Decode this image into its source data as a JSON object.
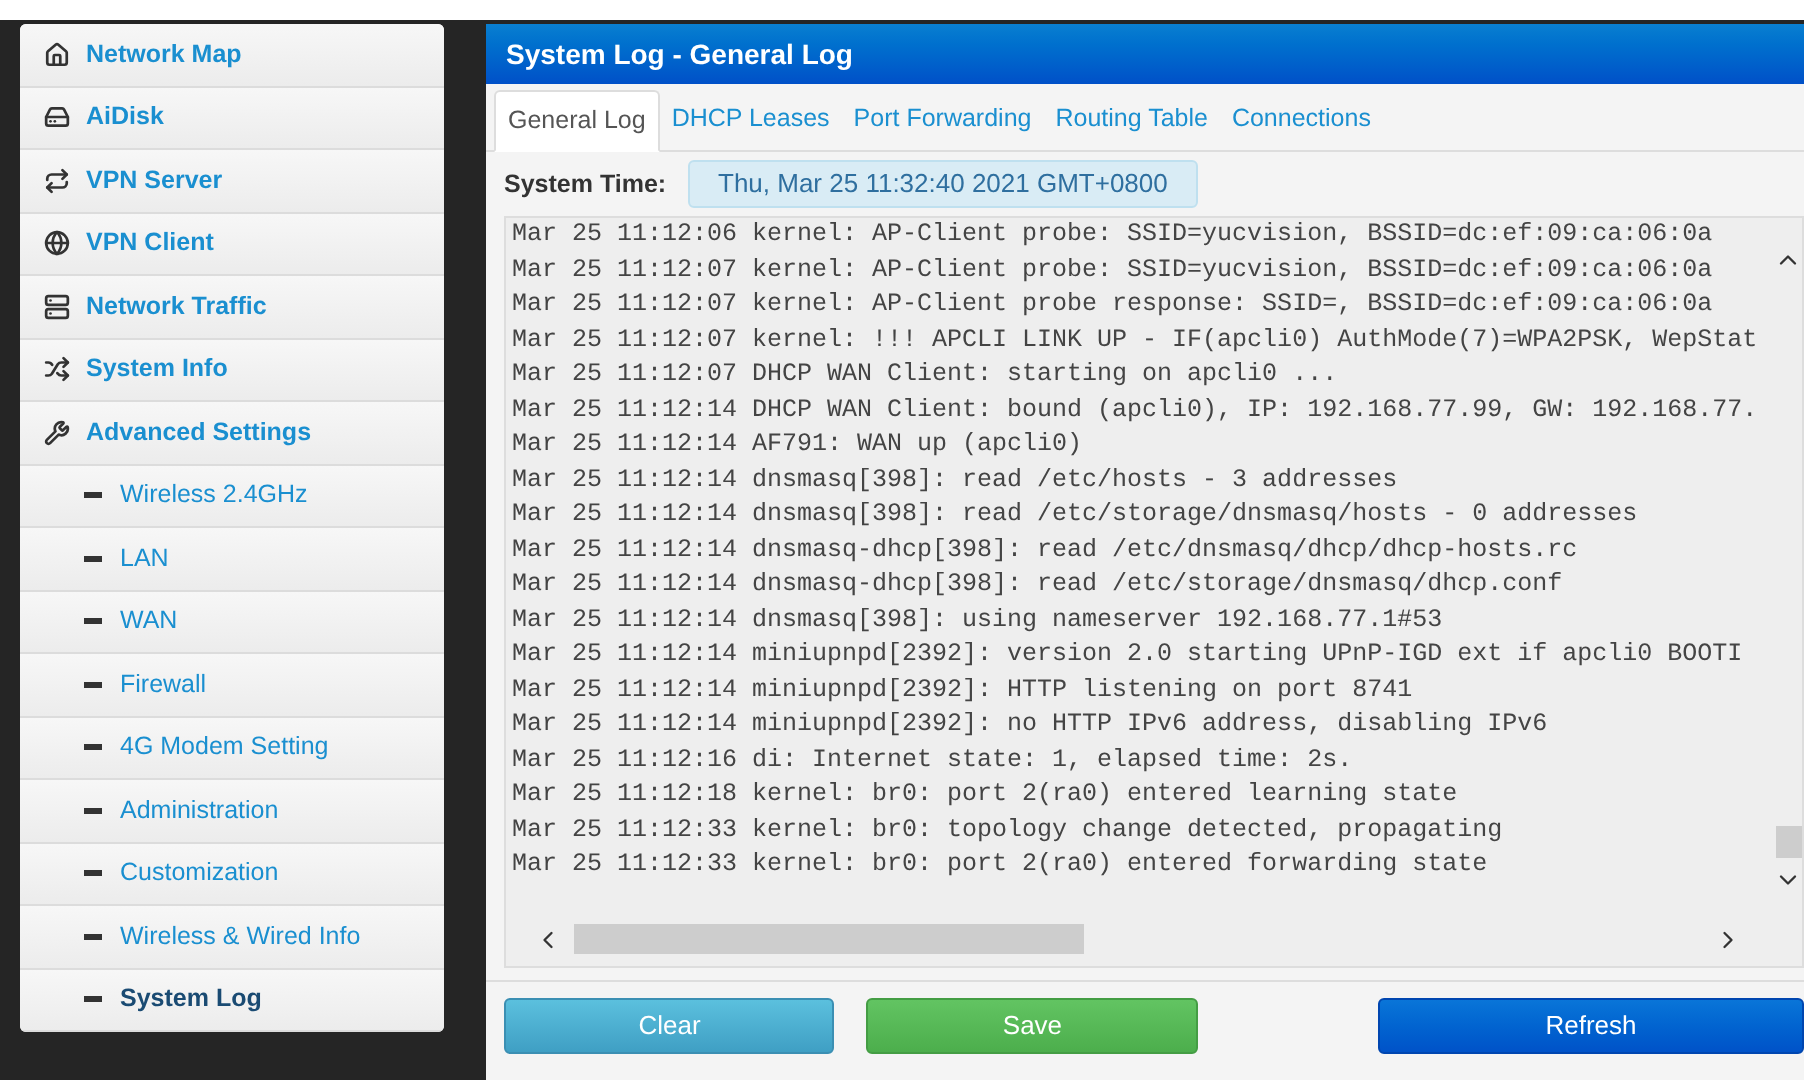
{
  "sidebar": {
    "items": [
      {
        "label": "Network Map",
        "selected": false
      },
      {
        "label": "AiDisk",
        "selected": false
      },
      {
        "label": "VPN Server",
        "selected": false
      },
      {
        "label": "VPN Client",
        "selected": false
      },
      {
        "label": "Network Traffic",
        "selected": false
      },
      {
        "label": "System Info",
        "selected": false
      },
      {
        "label": "Advanced Settings",
        "selected": false,
        "children": [
          {
            "label": "Wireless 2.4GHz",
            "selected": false
          },
          {
            "label": "LAN",
            "selected": false
          },
          {
            "label": "WAN",
            "selected": false
          },
          {
            "label": "Firewall",
            "selected": false
          },
          {
            "label": "4G Modem Setting",
            "selected": false
          },
          {
            "label": "Administration",
            "selected": false
          },
          {
            "label": "Customization",
            "selected": false
          },
          {
            "label": "Wireless & Wired Info",
            "selected": false
          },
          {
            "label": "System Log",
            "selected": true
          }
        ]
      }
    ]
  },
  "panel": {
    "title": "System Log - General Log",
    "tabs": [
      {
        "label": "General Log",
        "selected": true
      },
      {
        "label": "DHCP Leases",
        "selected": false
      },
      {
        "label": "Port Forwarding",
        "selected": false
      },
      {
        "label": "Routing Table",
        "selected": false
      },
      {
        "label": "Connections",
        "selected": false
      }
    ],
    "system_time": {
      "label": "System Time:",
      "value": "Thu, Mar 25 11:32:40 2021 GMT+0800"
    },
    "log_lines": [
      "Mar 25 11:12:06 kernel: AP-Client probe: SSID=yucvision, BSSID=dc:ef:09:ca:06:0a",
      "Mar 25 11:12:07 kernel: AP-Client probe: SSID=yucvision, BSSID=dc:ef:09:ca:06:0a",
      "Mar 25 11:12:07 kernel: AP-Client probe response: SSID=, BSSID=dc:ef:09:ca:06:0a",
      "Mar 25 11:12:07 kernel: !!! APCLI LINK UP - IF(apcli0) AuthMode(7)=WPA2PSK, WepStat",
      "Mar 25 11:12:07 DHCP WAN Client: starting on apcli0 ...",
      "Mar 25 11:12:14 DHCP WAN Client: bound (apcli0), IP: 192.168.77.99, GW: 192.168.77.",
      "Mar 25 11:12:14 AF791: WAN up (apcli0)",
      "Mar 25 11:12:14 dnsmasq[398]: read /etc/hosts - 3 addresses",
      "Mar 25 11:12:14 dnsmasq[398]: read /etc/storage/dnsmasq/hosts - 0 addresses",
      "Mar 25 11:12:14 dnsmasq-dhcp[398]: read /etc/dnsmasq/dhcp/dhcp-hosts.rc",
      "Mar 25 11:12:14 dnsmasq-dhcp[398]: read /etc/storage/dnsmasq/dhcp.conf",
      "Mar 25 11:12:14 dnsmasq[398]: using nameserver 192.168.77.1#53",
      "Mar 25 11:12:14 miniupnpd[2392]: version 2.0 starting UPnP-IGD ext if apcli0 BOOTI",
      "Mar 25 11:12:14 miniupnpd[2392]: HTTP listening on port 8741",
      "Mar 25 11:12:14 miniupnpd[2392]: no HTTP IPv6 address, disabling IPv6",
      "Mar 25 11:12:16 di: Internet state: 1, elapsed time: 2s.",
      "Mar 25 11:12:18 kernel: br0: port 2(ra0) entered learning state",
      "Mar 25 11:12:33 kernel: br0: topology change detected, propagating",
      "Mar 25 11:12:33 kernel: br0: port 2(ra0) entered forwarding state"
    ],
    "buttons": [
      {
        "label": "Clear",
        "kind": "info"
      },
      {
        "label": "Save",
        "kind": "success"
      },
      {
        "label": "Refresh",
        "kind": "primary"
      }
    ]
  }
}
